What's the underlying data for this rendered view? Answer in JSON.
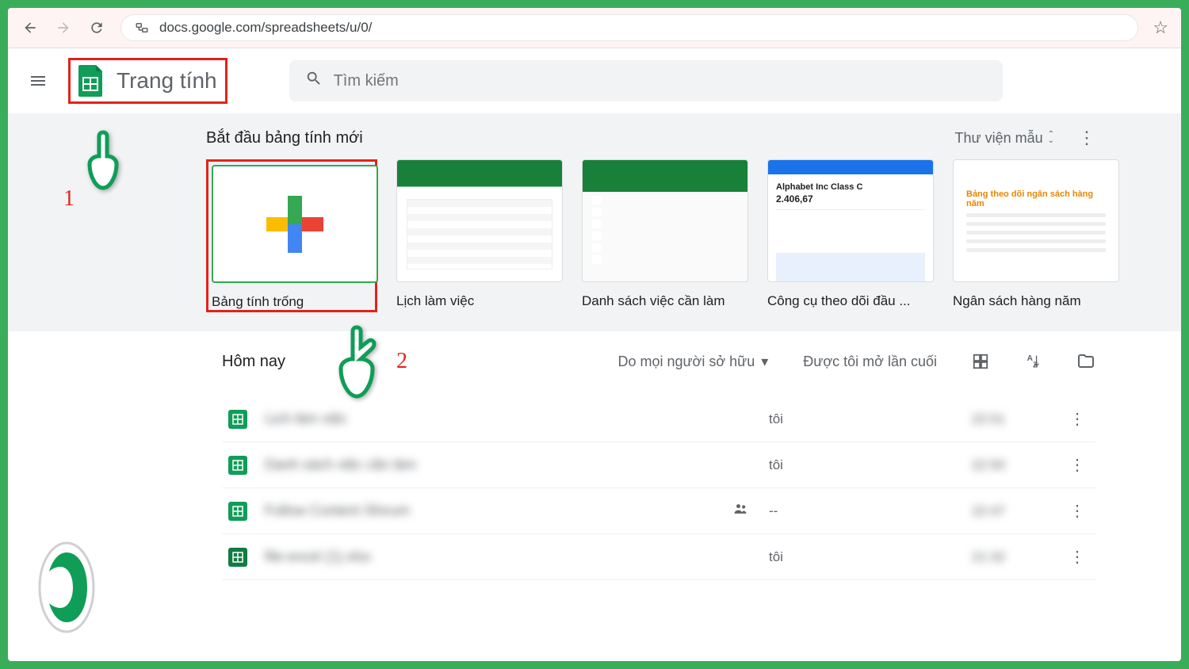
{
  "browser": {
    "url": "docs.google.com/spreadsheets/u/0/"
  },
  "header": {
    "app_title": "Trang tính",
    "search_placeholder": "Tìm kiếm"
  },
  "gallery": {
    "title": "Bắt đầu bảng tính mới",
    "template_gallery_label": "Thư viện mẫu",
    "templates": [
      {
        "label": "Bảng tính trống"
      },
      {
        "label": "Lịch làm việc"
      },
      {
        "label": "Danh sách việc cần làm"
      },
      {
        "label": "Công cụ theo dõi đầu ..."
      },
      {
        "label": "Ngân sách hàng năm"
      }
    ],
    "invest_thumb": {
      "title": "Alphabet Inc Class C",
      "price": "2.406,67"
    },
    "budget_thumb": {
      "title": "Bảng theo dõi ngân sách hàng năm"
    }
  },
  "recent": {
    "section_label": "Hôm nay",
    "owner_filter": "Do mọi người sở hữu",
    "opened_label": "Được tôi mở lần cuối",
    "files": [
      {
        "name": "Lịch làm việc",
        "owner": "tôi",
        "time": "22:51",
        "type": "sheets",
        "shared": false
      },
      {
        "name": "Danh sách việc cần làm",
        "owner": "tôi",
        "time": "22:50",
        "type": "sheets",
        "shared": false
      },
      {
        "name": "Follow Content Sforum",
        "owner": "--",
        "time": "22:47",
        "type": "sheets",
        "shared": true
      },
      {
        "name": "file-excel (1).xlsx",
        "owner": "tôi",
        "time": "21:32",
        "type": "excel",
        "shared": false
      }
    ]
  },
  "annotations": {
    "num1": "1",
    "num2": "2"
  }
}
